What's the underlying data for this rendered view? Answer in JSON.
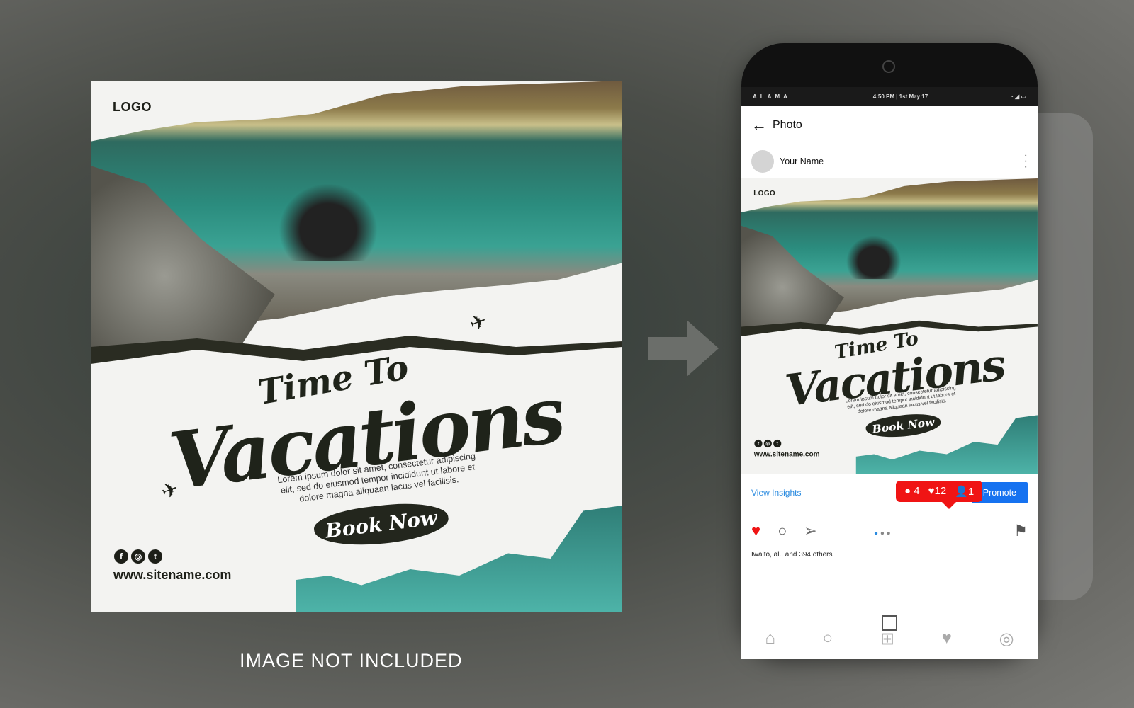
{
  "post": {
    "logo": "LOGO",
    "title_line1": "Time To",
    "title_line2": "Vacations",
    "body": "Lorem ipsum dolor sit amet, consectetur adipiscing elit, sed do eiusmod tempor incididunt ut labore et dolore magna aliquaan lacus vel facilisis.",
    "cta": "Book Now",
    "social": [
      "f",
      "◎",
      "t"
    ],
    "site": "www.sitename.com"
  },
  "caption": "IMAGE NOT INCLUDED",
  "phone": {
    "carrier": "ALAMA",
    "time": "4:50 PM | 1st May 17",
    "header_title": "Photo",
    "user_name": "Your Name",
    "view_insights": "View Insights",
    "promote": "Promote",
    "likes_text": "Iwaito, al.. and 394 others",
    "notifications": {
      "comments": "4",
      "likes": "12",
      "followers": "1"
    },
    "colors": {
      "accent": "#1672f0",
      "notification": "#f01414",
      "like": "#f01414"
    }
  }
}
